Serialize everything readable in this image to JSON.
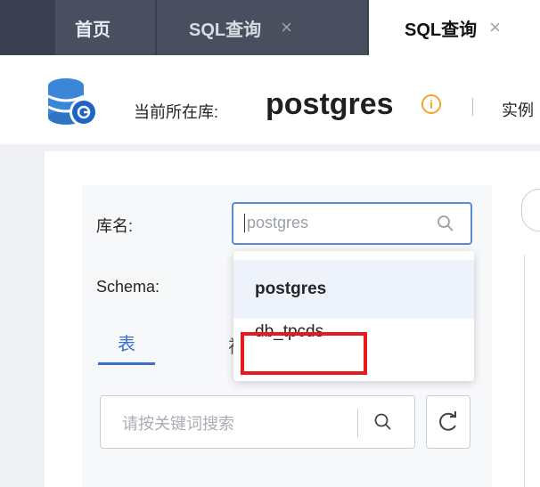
{
  "tabs": [
    {
      "label": "首页"
    },
    {
      "label": "SQL查询",
      "close": "×"
    },
    {
      "label": "SQL查询",
      "close": "×"
    }
  ],
  "db_header": {
    "current_db_label": "当前所在库:",
    "current_db_name": "postgres",
    "info_glyph": "i",
    "divider": "|",
    "instance_label": "实例"
  },
  "filters": {
    "db_label": "库名:",
    "db_value": "postgres",
    "schema_label": "Schema:",
    "tabs": [
      {
        "label": "表"
      },
      {
        "label": "视"
      }
    ],
    "keyword_placeholder": "请按关键词搜索"
  },
  "dropdown": {
    "options": [
      {
        "label": "postgres"
      },
      {
        "label": "db_tpcds"
      }
    ],
    "selected": "postgres"
  },
  "colors": {
    "tabbar": "#3b4050",
    "accent": "#3a6ecf",
    "highlight": "#e8191b",
    "info": "#f5a623"
  }
}
